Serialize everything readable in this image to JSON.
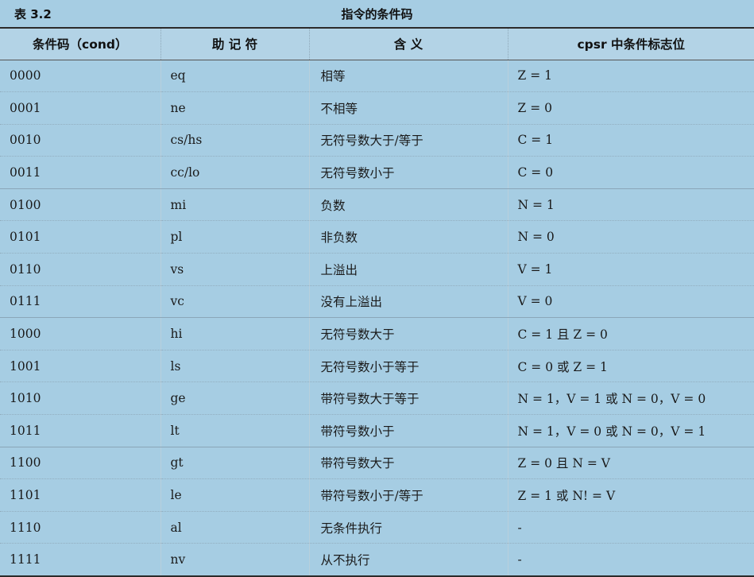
{
  "caption": {
    "number": "表 3.2",
    "title": "指令的条件码"
  },
  "headers": [
    "条件码（cond）",
    "助 记 符",
    "含 义",
    "cpsr 中条件标志位"
  ],
  "rows": [
    [
      "0000",
      "eq",
      "相等",
      "Z = 1"
    ],
    [
      "0001",
      "ne",
      "不相等",
      "Z = 0"
    ],
    [
      "0010",
      "cs/hs",
      "无符号数大于/等于",
      "C = 1"
    ],
    [
      "0011",
      "cc/lo",
      "无符号数小于",
      "C = 0"
    ],
    [
      "0100",
      "mi",
      "负数",
      "N = 1"
    ],
    [
      "0101",
      "pl",
      "非负数",
      "N = 0"
    ],
    [
      "0110",
      "vs",
      "上溢出",
      "V = 1"
    ],
    [
      "0111",
      "vc",
      "没有上溢出",
      "V = 0"
    ],
    [
      "1000",
      "hi",
      "无符号数大于",
      "C = 1 且 Z = 0"
    ],
    [
      "1001",
      "ls",
      "无符号数小于等于",
      "C = 0 或 Z = 1"
    ],
    [
      "1010",
      "ge",
      "带符号数大于等于",
      "N = 1，V = 1 或 N = 0，V = 0"
    ],
    [
      "1011",
      "lt",
      "带符号数小于",
      "N = 1，V = 0 或 N = 0，V = 1"
    ],
    [
      "1100",
      "gt",
      "带符号数大于",
      "Z = 0 且 N = V"
    ],
    [
      "1101",
      "le",
      "带符号数小于/等于",
      "Z = 1 或 N!  = V"
    ],
    [
      "1110",
      "al",
      "无条件执行",
      "-"
    ],
    [
      "1111",
      "nv",
      "从不执行",
      "-"
    ]
  ]
}
